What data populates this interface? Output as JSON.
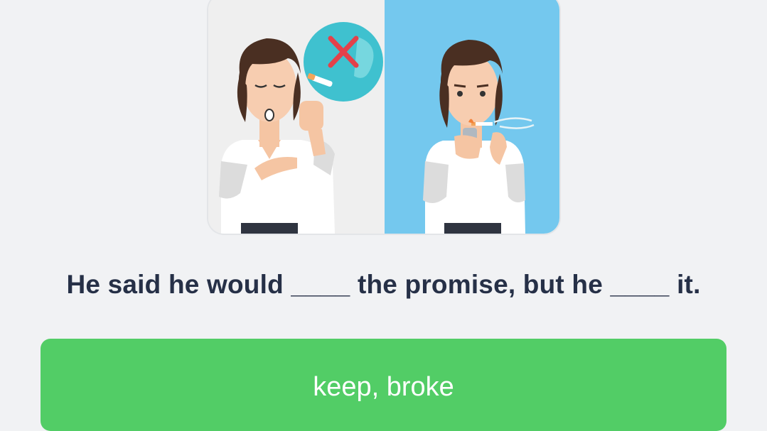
{
  "illustration": {
    "left_panel": "not smoking",
    "right_panel": "smoking",
    "colors": {
      "left_bg": "#efefef",
      "right_bg": "#74c8ee",
      "no_badge": "#3fc1cf",
      "cross": "#e3414a"
    }
  },
  "question": {
    "text": "He said he would ____ the promise, but he ____ it."
  },
  "answer": {
    "label": "keep, broke",
    "color": "#52cd66"
  }
}
